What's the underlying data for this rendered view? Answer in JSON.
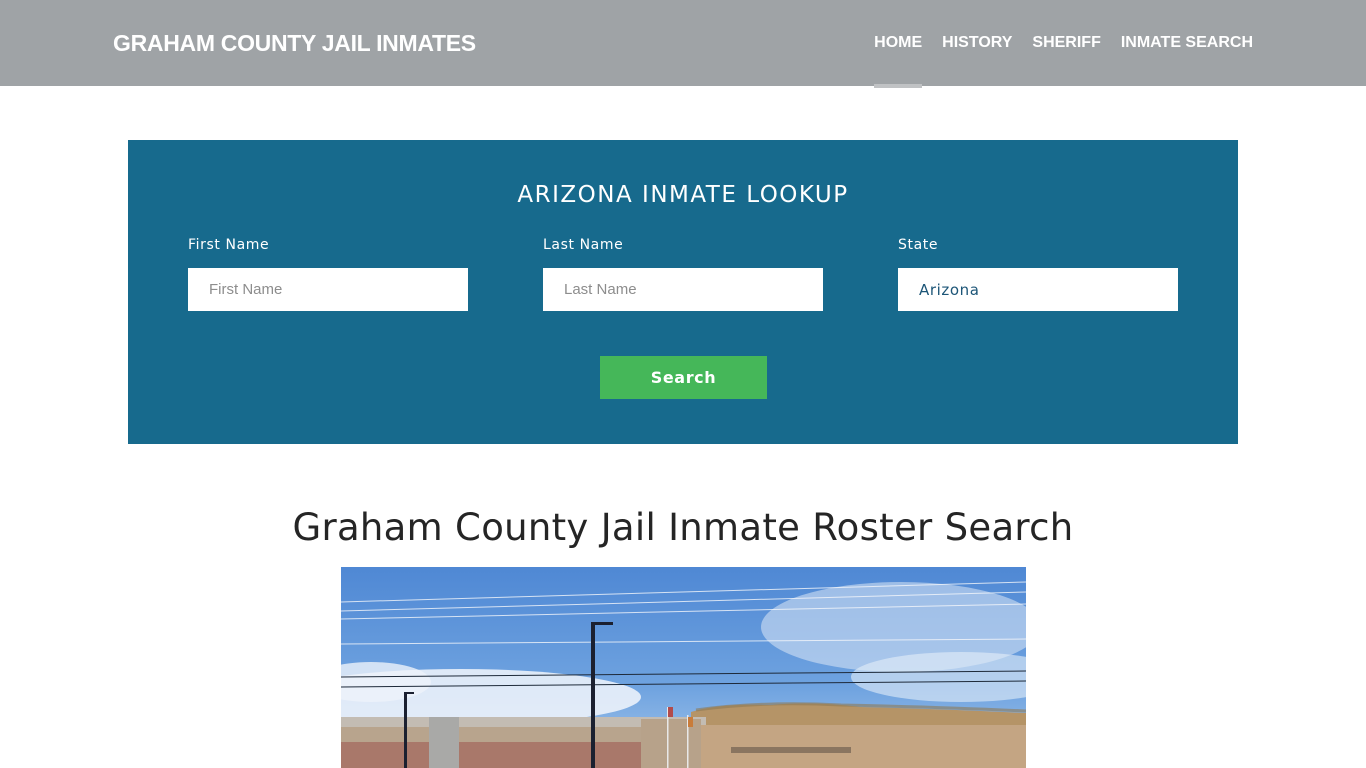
{
  "header": {
    "brand": "GRAHAM COUNTY JAIL INMATES",
    "nav": [
      {
        "label": "HOME",
        "active": true
      },
      {
        "label": "HISTORY",
        "active": false
      },
      {
        "label": "SHERIFF",
        "active": false
      },
      {
        "label": "INMATE SEARCH",
        "active": false
      }
    ]
  },
  "lookup": {
    "title": "ARIZONA INMATE LOOKUP",
    "first_name": {
      "label": "First Name",
      "placeholder": "First Name",
      "value": ""
    },
    "last_name": {
      "label": "Last Name",
      "placeholder": "Last Name",
      "value": ""
    },
    "state": {
      "label": "State",
      "value": "Arizona"
    },
    "search_label": "Search"
  },
  "main": {
    "title": "Graham County Jail Inmate Roster Search",
    "image": {
      "description": "Graham County jail building exterior with light poles, flags and desert hill under blue sky"
    }
  },
  "colors": {
    "header_bg": "#9fa3a6",
    "panel_bg": "#176a8d",
    "button_bg": "#45b759",
    "active_indicator": "#c0c2c4"
  }
}
